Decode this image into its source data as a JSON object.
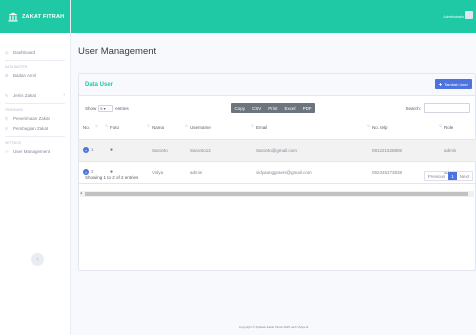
{
  "brand": {
    "name": "ZAKAT FITRAH",
    "icon": "landmark-icon"
  },
  "sidebar": {
    "items": [
      {
        "label": "Dashboard",
        "icon": "dashboard-icon"
      },
      {
        "heading": "DATA MASTER"
      },
      {
        "label": "Badan Amil",
        "icon": "gear-icon"
      },
      {
        "label": "Jenis Zakat",
        "icon": "bullhorn-icon",
        "chevron": "›"
      },
      {
        "heading": "TRANSAKSI"
      },
      {
        "label": "Penerimaan Zakat",
        "icon": "user-icon"
      },
      {
        "label": "Pembagian Zakat",
        "icon": "user-icon"
      },
      {
        "heading": "SETTINGS"
      },
      {
        "label": "User Management",
        "icon": "users-icon"
      }
    ],
    "toggle_symbol": "‹"
  },
  "topbar": {
    "username": "Administrator"
  },
  "page": {
    "title": "User Management"
  },
  "card": {
    "title": "Data User",
    "add_button": "Tambah User",
    "show_label": "Show",
    "entries_value": "5",
    "entries_label": "entries",
    "export_buttons": [
      "Copy",
      "CSV",
      "Print",
      "Excel",
      "PDF"
    ],
    "search_label": "Search:",
    "columns": [
      "No.",
      "Foto",
      "Nama",
      "Username",
      "Email",
      "No. telp",
      "Role"
    ],
    "rows": [
      {
        "no": "1",
        "nama": "Saronto",
        "username": "Saronto12",
        "email": "Saronto@gmail.com",
        "telp": "081221528806",
        "role": "admin"
      },
      {
        "no": "2",
        "nama": "Vidya",
        "username": "admin",
        "email": "vidyaanggraeni@gmail.com",
        "telp": "082345273838",
        "role": "admin"
      }
    ],
    "info": "Showing 1 to 2 of 2 entries",
    "pager": {
      "previous": "Previous",
      "current": "1",
      "next": "Next"
    }
  },
  "footer": {
    "text": "Copyright © Aplikasi Zakat Fitrah 2020 oleh Vidya dl"
  },
  "colors": {
    "accent": "#20c9a6",
    "primary": "#4e73df"
  }
}
